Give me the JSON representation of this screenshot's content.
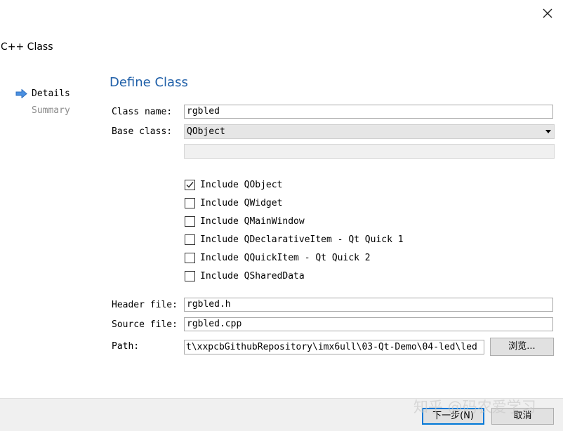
{
  "window": {
    "title": "C++ Class",
    "close_icon": "close-icon"
  },
  "nav": {
    "items": [
      {
        "label": "Details",
        "active": true
      },
      {
        "label": "Summary",
        "active": false
      }
    ],
    "arrow_icon": "arrow-right-icon",
    "arrow_color": "#4a90e2"
  },
  "page": {
    "title": "Define Class",
    "title_color": "#1f5fa8"
  },
  "form": {
    "class_name_label": "Class name:",
    "class_name_value": "rgbled",
    "base_class_label": "Base class:",
    "base_class_value": "QObject",
    "header_file_label": "Header file:",
    "header_file_value": "rgbled.h",
    "source_file_label": "Source file:",
    "source_file_value": "rgbled.cpp",
    "path_label": "Path:",
    "path_value": "t\\xxpcbGithubRepository\\imx6ull\\03-Qt-Demo\\04-led\\led",
    "browse_label": "浏览..."
  },
  "checkboxes": [
    {
      "label": "Include QObject",
      "checked": true
    },
    {
      "label": "Include QWidget",
      "checked": false
    },
    {
      "label": "Include QMainWindow",
      "checked": false
    },
    {
      "label": "Include QDeclarativeItem - Qt Quick 1",
      "checked": false
    },
    {
      "label": "Include QQuickItem - Qt Quick 2",
      "checked": false
    },
    {
      "label": "Include QSharedData",
      "checked": false
    }
  ],
  "footer": {
    "next_label": "下一步(N)",
    "cancel_label": "取消"
  },
  "watermark": {
    "text": "知乎 @码农爱学习"
  }
}
